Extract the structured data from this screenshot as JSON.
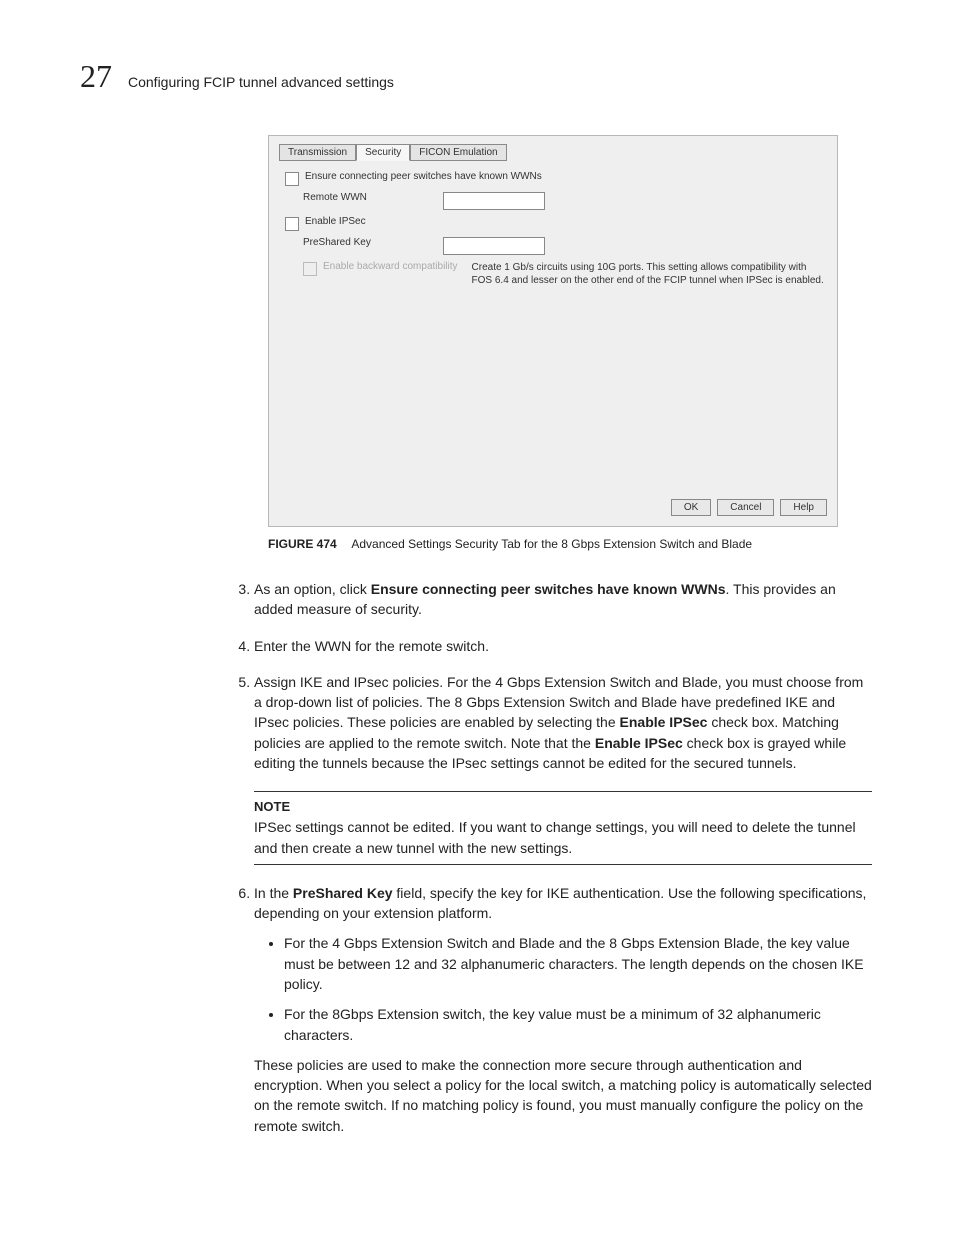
{
  "header": {
    "chapter": "27",
    "title": "Configuring FCIP tunnel advanced settings"
  },
  "dialog": {
    "tabs": {
      "transmission": "Transmission",
      "security": "Security",
      "ficon": "FICON Emulation"
    },
    "ensure": "Ensure connecting peer switches have known WWNs",
    "remote": "Remote WWN",
    "enable_ipsec": "Enable IPSec",
    "preshared": "PreShared Key",
    "backcompat": "Enable backward compatibility",
    "backcompat_help": "Create 1 Gb/s circuits using 10G ports. This setting allows compatibility with FOS 6.4 and lesser on the other end of the FCIP tunnel when IPSec is enabled.",
    "ok": "OK",
    "cancel": "Cancel",
    "help": "Help"
  },
  "figcap": {
    "num": "FIGURE 474",
    "text": "Advanced Settings Security Tab for the 8 Gbps Extension Switch and Blade"
  },
  "steps": {
    "s3a": "As an option, click ",
    "s3b": "Ensure connecting peer switches have known WWNs",
    "s3c": ". This provides an added measure of security.",
    "s4": "Enter the WWN for the remote switch.",
    "s5a": "Assign IKE and IPsec policies. For the 4 Gbps Extension Switch and Blade, you must choose from a drop-down list of policies. The 8 Gbps Extension Switch and Blade have predefined IKE and IPsec policies. These policies are enabled by selecting the ",
    "s5b": "Enable IPSec",
    "s5c": " check box. Matching policies are applied to the remote switch. Note that the ",
    "s5d": "Enable IPSec",
    "s5e": " check box is grayed while editing the tunnels because the IPsec settings cannot be edited for the secured tunnels.",
    "s6a": "In the ",
    "s6b": "PreShared Key",
    "s6c": " field, specify the key for IKE authentication. Use the following specifications, depending on your extension platform.",
    "s6_b1": "For the 4 Gbps Extension Switch and Blade and the 8 Gbps Extension Blade, the key value must be between 12 and 32 alphanumeric characters. The length depends on the chosen IKE policy.",
    "s6_b2": "For the 8Gbps Extension switch, the key value must be a minimum of 32 alphanumeric characters.",
    "s6_tail": "These policies are used to make the connection more secure through authentication and encryption. When you select a policy for the local switch, a matching policy is automatically selected on the remote switch. If no matching policy is found, you must manually configure the policy on the remote switch."
  },
  "note": {
    "h": "NOTE",
    "t": "IPSec settings cannot be edited. If you want to change settings, you will need to delete the tunnel and then create a new tunnel with the new settings."
  }
}
